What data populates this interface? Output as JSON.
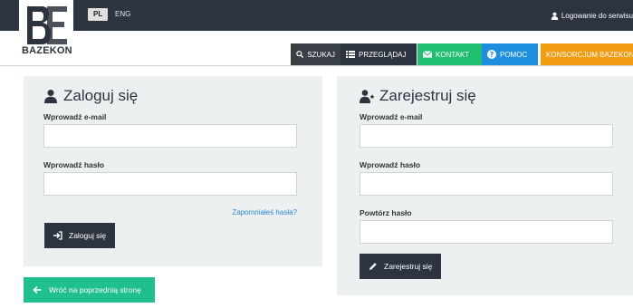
{
  "header": {
    "logo_text": "BAZEKON",
    "lang_pl": "PL",
    "lang_eng": "ENG",
    "login_link": "Logowanie do serwisu"
  },
  "nav": {
    "szukaj": "SZUKAJ",
    "przegladaj": "PRZEGLĄDAJ",
    "kontakt": "KONTAKT",
    "pomoc": "POMOC",
    "konsorcjum": "KONSORCJUM BAZEKON"
  },
  "login": {
    "title": "Zaloguj się",
    "email_label": "Wprowadź e-mail",
    "email_value": "",
    "password_label": "Wprowadź hasło",
    "password_value": "",
    "forgot": "Zapomniałeś hasła?",
    "submit": "Zaloguj się"
  },
  "register": {
    "title": "Zarejestruj się",
    "email_label": "Wprowadź e-mail",
    "email_value": "",
    "password_label": "Wprowadź hasło",
    "password_value": "",
    "repeat_label": "Powtórz hasło",
    "repeat_value": "",
    "submit": "Zarejestruj się"
  },
  "back_button": "Wróć na poprzednią stronę",
  "colors": {
    "topbar": "#2c3440",
    "kontakt": "#1fbf6f",
    "pomoc": "#1e8fe0",
    "konsorcjum": "#f39c12",
    "back": "#1fbf8f",
    "link": "#2a8ad6"
  }
}
